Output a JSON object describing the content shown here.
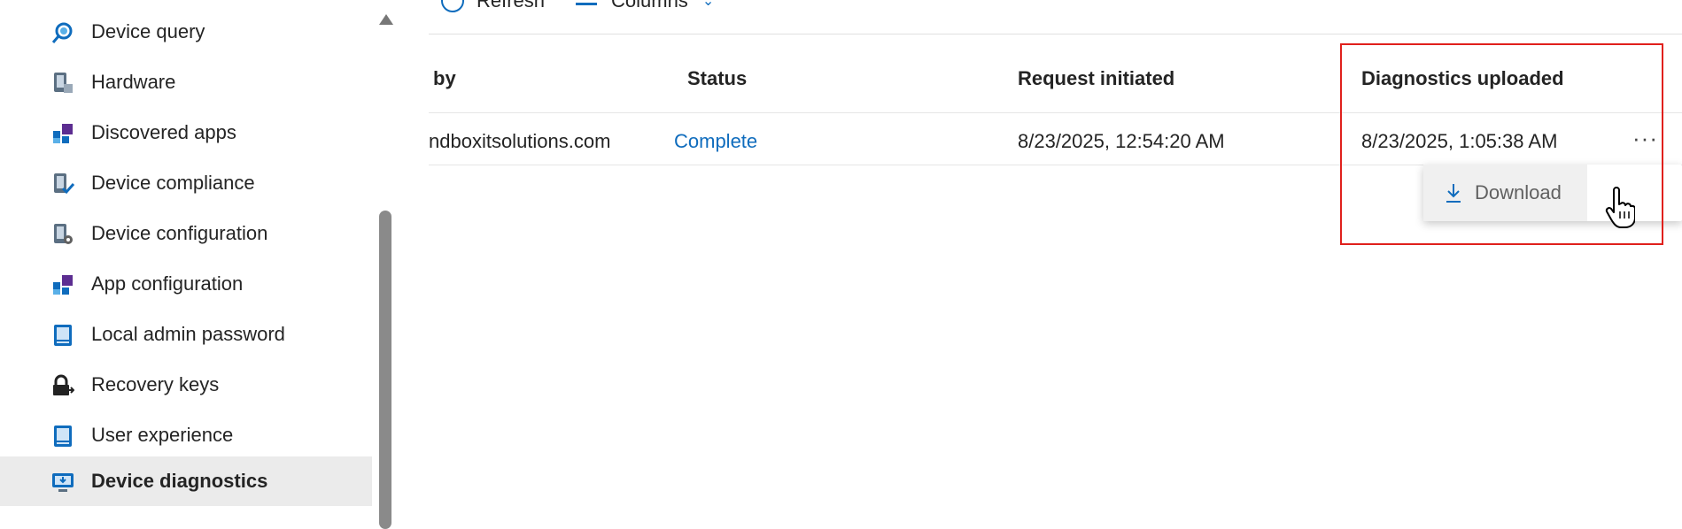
{
  "sidebar": {
    "items": [
      {
        "label": "Device query",
        "icon": "device-query-icon"
      },
      {
        "label": "Hardware",
        "icon": "hardware-icon"
      },
      {
        "label": "Discovered apps",
        "icon": "apps-icon"
      },
      {
        "label": "Device compliance",
        "icon": "compliance-icon"
      },
      {
        "label": "Device configuration",
        "icon": "configuration-icon"
      },
      {
        "label": "App configuration",
        "icon": "app-config-icon"
      },
      {
        "label": "Local admin password",
        "icon": "password-icon"
      },
      {
        "label": "Recovery keys",
        "icon": "lock-icon"
      },
      {
        "label": "User experience",
        "icon": "user-experience-icon"
      },
      {
        "label": "Device diagnostics",
        "icon": "diagnostics-icon",
        "active": true
      }
    ]
  },
  "toolbar": {
    "refresh_label": "Refresh",
    "columns_label": "Columns"
  },
  "table": {
    "columns": [
      "by",
      "Status",
      "Request initiated",
      "Diagnostics uploaded"
    ],
    "rows": [
      {
        "requested_by": "ndboxitsolutions.com",
        "status": "Complete",
        "request_initiated": "8/23/2025, 12:54:20 AM",
        "diagnostics_uploaded": "8/23/2025, 1:05:38 AM"
      }
    ]
  },
  "context_menu": {
    "more_label": "···",
    "download_label": "Download"
  },
  "colors": {
    "accent": "#0f6cbd",
    "highlight": "#e0201c",
    "active_bg": "#ebebeb"
  }
}
